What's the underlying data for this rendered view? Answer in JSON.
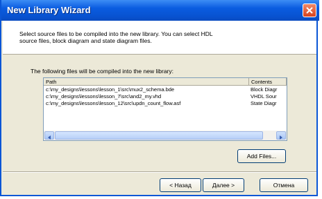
{
  "window": {
    "title": "New Library Wizard"
  },
  "header": {
    "description": "Select source files to be compiled into the new library. You can select HDL source files, block diagram and state diagram files."
  },
  "list": {
    "caption": "The following files will be compiled into the new library:",
    "columns": [
      "Path",
      "Contents"
    ],
    "rows": [
      {
        "path": "c:\\my_designs\\lessons\\lesson_1\\src\\mux2_schema.bde",
        "contents": "Block Diagr"
      },
      {
        "path": "c:\\my_designs\\lessons\\lesson_7\\src\\and2_my.vhd",
        "contents": "VHDL Sour"
      },
      {
        "path": "c:\\my_designs\\lessons\\lesson_12\\src\\updn_count_flow.asf",
        "contents": "State Diagr"
      }
    ]
  },
  "buttons": {
    "add_files": "Add Files...",
    "back": "< Назад",
    "next": "Далее >",
    "cancel": "Отмена"
  },
  "colors": {
    "titlebar": "#0a5ce0",
    "face": "#ece9d8",
    "close": "#d8421e"
  },
  "icons": {
    "close": "close-icon",
    "left_arrow": "left-arrow-icon",
    "right_arrow": "right-arrow-icon"
  }
}
